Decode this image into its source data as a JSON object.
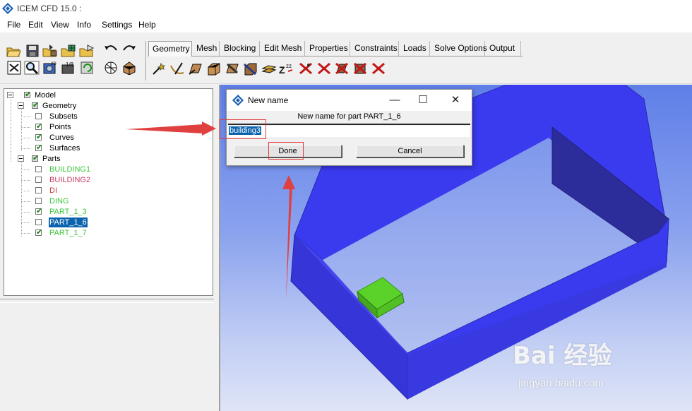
{
  "window": {
    "title": "ICEM CFD 15.0 :"
  },
  "menu": [
    "File",
    "Edit",
    "View",
    "Info",
    "Settings",
    "Help"
  ],
  "toolbar": {
    "left_icons": [
      "open-icon",
      "save-icon",
      "import-geometry-icon",
      "import-mesh-icon",
      "export-icon",
      "undo-icon",
      "redo-icon",
      "fit-window-icon",
      "zoom-icon",
      "measure-icon",
      "shading-icon",
      "refresh-icon",
      "wireframe-icon",
      "solid-icon"
    ],
    "tool_icons": [
      "create-point-icon",
      "create-curve-icon",
      "create-surface-icon",
      "create-body-icon",
      "repair-icon",
      "transform-icon",
      "restore-icon",
      "delete-point-icon",
      "delete-curve-icon",
      "delete-surface-icon",
      "delete-body-icon",
      "delete-any-icon"
    ]
  },
  "tabs": [
    "Geometry",
    "Mesh",
    "Blocking",
    "Edit Mesh",
    "Properties",
    "Constraints",
    "Loads",
    "Solve Options",
    "Output"
  ],
  "tree": {
    "model": "Model",
    "geometry": "Geometry",
    "geometry_items": [
      {
        "label": "Subsets",
        "checked": false
      },
      {
        "label": "Points",
        "checked": true
      },
      {
        "label": "Curves",
        "checked": true
      },
      {
        "label": "Surfaces",
        "checked": true
      }
    ],
    "parts": "Parts",
    "part_items": [
      {
        "label": "BUILDING1",
        "checked": false,
        "color": "#3cc83c"
      },
      {
        "label": "BUILDING2",
        "checked": false,
        "color": "#c83c64"
      },
      {
        "label": "DI",
        "checked": false,
        "color": "#c84040"
      },
      {
        "label": "DING",
        "checked": false,
        "color": "#3cc83c"
      },
      {
        "label": "PART_1_3",
        "checked": true,
        "color": "#3cc83c"
      },
      {
        "label": "PART_1_6",
        "checked": false,
        "color": "#ffffff",
        "selected": true
      },
      {
        "label": "PART_1_7",
        "checked": true,
        "color": "#3cc83c"
      }
    ]
  },
  "dialog": {
    "title": "New name",
    "prompt": "New name for part PART_1_6",
    "value": "building3",
    "done_label": "Done",
    "cancel_label": "Cancel",
    "minimize": "—",
    "maximize": "☐",
    "close": "✕"
  },
  "colors": {
    "wall": "#3a3aee",
    "block": "#5ad22a",
    "annotation": "#e03a3a",
    "selection": "#0a64ad"
  },
  "watermark": {
    "logo": "Bai 经验",
    "url": "jingyan.baidu.com"
  }
}
